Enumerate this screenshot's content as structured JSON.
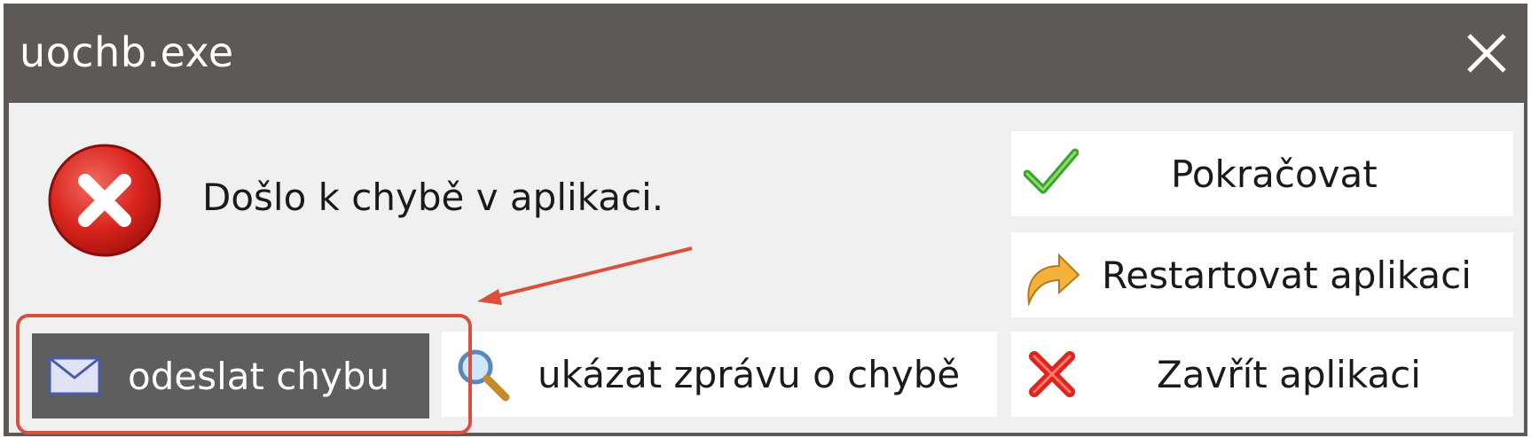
{
  "window": {
    "title": "uochb.exe",
    "close_icon": "close-icon"
  },
  "message": {
    "text": "Došlo k chybě v aplikaci.",
    "icon": "error-icon"
  },
  "buttons": {
    "continue": {
      "label": "Pokračovat",
      "icon": "checkmark-icon"
    },
    "restart": {
      "label": "Restartovat aplikaci",
      "icon": "curved-arrow-icon"
    },
    "close_app": {
      "label": "Zavřít aplikaci",
      "icon": "red-x-icon"
    },
    "show_report": {
      "label": "ukázat zprávu o chybě",
      "icon": "magnifier-icon"
    },
    "send_error": {
      "label": "odeslat chybu",
      "icon": "envelope-icon"
    }
  },
  "annotation": {
    "highlight_color": "#d9503f",
    "target": "send_error"
  },
  "colors": {
    "titlebar": "#5e5955",
    "client_bg": "#f0f0f0",
    "send_button_bg": "#5e5e5e"
  }
}
